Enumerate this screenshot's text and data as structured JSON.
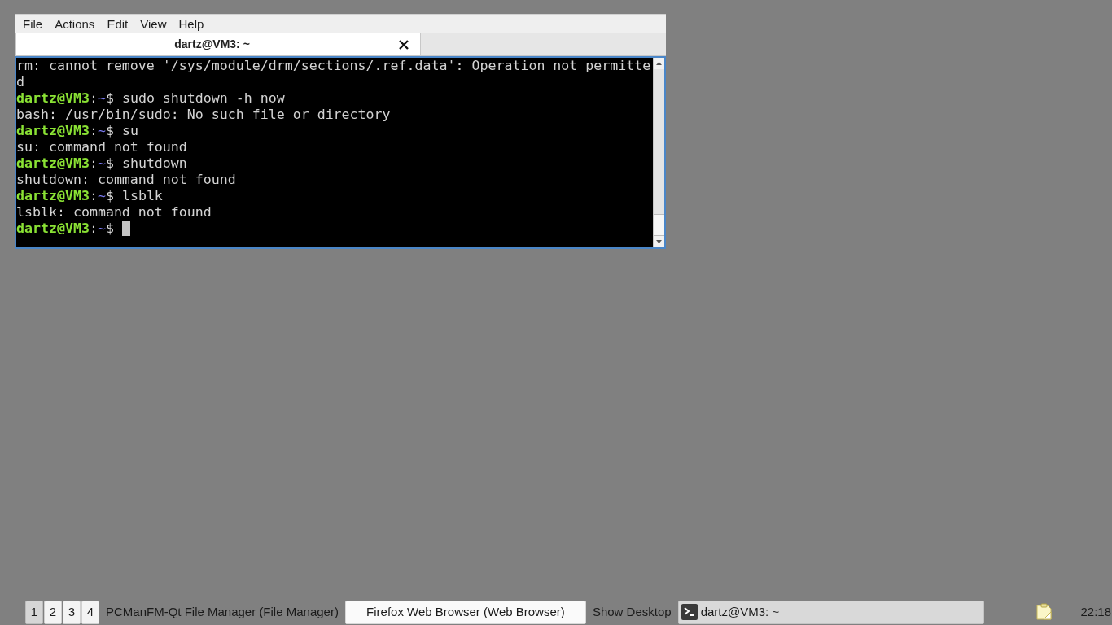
{
  "window": {
    "menu": [
      "File",
      "Actions",
      "Edit",
      "View",
      "Help"
    ],
    "tabs": [
      {
        "title": "dartz@VM3: ~",
        "selected": true
      }
    ]
  },
  "terminal": {
    "lines": [
      {
        "kind": "output",
        "text": "rm: cannot remove '/sys/module/drm/sections/.ref.data': Operation not permitte"
      },
      {
        "kind": "output",
        "text": "d"
      },
      {
        "kind": "prompt",
        "user": "dartz@VM3",
        "separator": ":",
        "path": "~",
        "symbol": "$",
        "command": "sudo shutdown -h now"
      },
      {
        "kind": "output",
        "text": "bash: /usr/bin/sudo: No such file or directory"
      },
      {
        "kind": "prompt",
        "user": "dartz@VM3",
        "separator": ":",
        "path": "~",
        "symbol": "$",
        "command": "su"
      },
      {
        "kind": "output",
        "text": "su: command not found"
      },
      {
        "kind": "prompt",
        "user": "dartz@VM3",
        "separator": ":",
        "path": "~",
        "symbol": "$",
        "command": "shutdown"
      },
      {
        "kind": "output",
        "text": "shutdown: command not found"
      },
      {
        "kind": "prompt",
        "user": "dartz@VM3",
        "separator": ":",
        "path": "~",
        "symbol": "$",
        "command": "lsblk"
      },
      {
        "kind": "output",
        "text": "lsblk: command not found"
      },
      {
        "kind": "prompt",
        "user": "dartz@VM3",
        "separator": ":",
        "path": "~",
        "symbol": "$"
      }
    ],
    "cursor": true
  },
  "taskbar": {
    "desktops": [
      {
        "label": "1",
        "selected": true
      },
      {
        "label": "2",
        "selected": false
      },
      {
        "label": "3",
        "selected": false
      },
      {
        "label": "4",
        "selected": false
      }
    ],
    "entries": [
      {
        "kind": "label",
        "label": "PCManFM-Qt File Manager (File Manager)",
        "selected": false
      },
      {
        "kind": "button",
        "label": "Firefox Web Browser (Web Browser)",
        "selected": false
      },
      {
        "kind": "label",
        "label": "Show Desktop",
        "selected": false
      },
      {
        "kind": "task",
        "label": "dartz@VM3: ~",
        "selected": true
      }
    ],
    "clock": "22:18"
  }
}
